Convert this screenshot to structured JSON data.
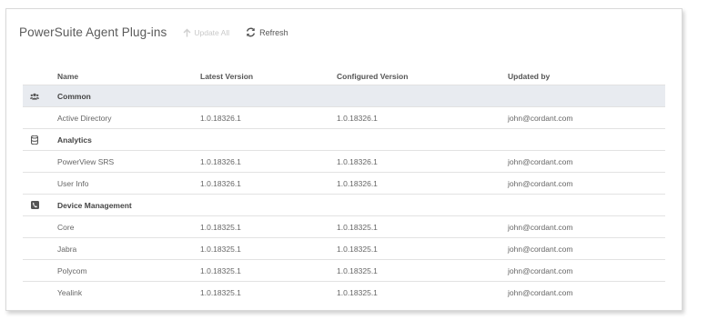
{
  "header": {
    "title": "PowerSuite Agent Plug-ins",
    "update_all_label": "Update All",
    "refresh_label": "Refresh"
  },
  "columns": {
    "name": "Name",
    "latest": "Latest Version",
    "configured": "Configured Version",
    "updated_by": "Updated by"
  },
  "groups": [
    {
      "label": "Common",
      "icon": "users-icon",
      "rows": [
        {
          "name": "Active Directory",
          "latest": "1.0.18326.1",
          "configured": "1.0.18326.1",
          "updated_by": "john@cordant.com"
        }
      ]
    },
    {
      "label": "Analytics",
      "icon": "database-icon",
      "rows": [
        {
          "name": "PowerView SRS",
          "latest": "1.0.18326.1",
          "configured": "1.0.18326.1",
          "updated_by": "john@cordant.com"
        },
        {
          "name": "User Info",
          "latest": "1.0.18326.1",
          "configured": "1.0.18326.1",
          "updated_by": "john@cordant.com"
        }
      ]
    },
    {
      "label": "Device Management",
      "icon": "phone-square-icon",
      "rows": [
        {
          "name": "Core",
          "latest": "1.0.18325.1",
          "configured": "1.0.18325.1",
          "updated_by": "john@cordant.com"
        },
        {
          "name": "Jabra",
          "latest": "1.0.18325.1",
          "configured": "1.0.18325.1",
          "updated_by": "john@cordant.com"
        },
        {
          "name": "Polycom",
          "latest": "1.0.18325.1",
          "configured": "1.0.18325.1",
          "updated_by": "john@cordant.com"
        },
        {
          "name": "Yealink",
          "latest": "1.0.18325.1",
          "configured": "1.0.18325.1",
          "updated_by": "john@cordant.com"
        }
      ]
    }
  ]
}
